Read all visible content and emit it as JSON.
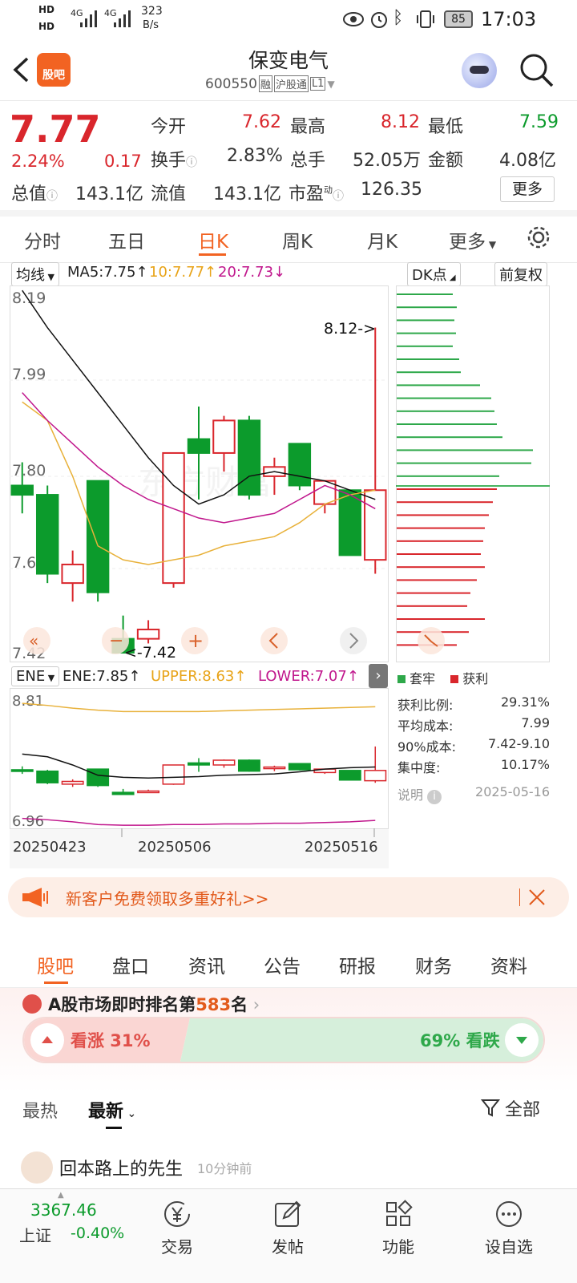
{
  "status_bar": {
    "hd1": "HD",
    "hd2": "HD",
    "sig1": "4G",
    "sig2": "4G",
    "speed_value": "323",
    "speed_unit": "B/s",
    "battery": "85",
    "time": "17:03"
  },
  "header": {
    "logo_text": "股吧",
    "title": "保变电气",
    "code": "600550",
    "tag_rong": "融",
    "tag_hgt": "沪股通",
    "tag_level": "L1"
  },
  "quote": {
    "price": "7.77",
    "change_pct": "2.24%",
    "change": "0.17",
    "open_label": "今开",
    "open": "7.62",
    "high_label": "最高",
    "high": "8.12",
    "low_label": "最低",
    "low": "7.59",
    "turnover_label": "换手",
    "turnover": "2.83%",
    "volume_label": "总手",
    "volume": "52.05万",
    "amount_label": "金额",
    "amount": "4.08亿",
    "mcap_label": "总值",
    "mcap": "143.1亿",
    "float_label": "流值",
    "float": "143.1亿",
    "pe_label": "市盈",
    "pe_sup": "动",
    "pe": "126.35",
    "more_label": "更多"
  },
  "period_tabs": [
    "分时",
    "五日",
    "日K",
    "周K",
    "月K",
    "更多"
  ],
  "active_tab": 2,
  "kline": {
    "ma_selector": "均线",
    "ma5": "MA5:7.75",
    "ma10": "10:7.77",
    "ma20": "20:7.73",
    "dk_label": "DK点",
    "fuquan": "前复权",
    "y_labels": [
      "8.19",
      "7.99",
      "7.80",
      "7.61",
      "7.42"
    ],
    "max_marker": "8.12->",
    "min_marker": "<-7.42",
    "watermark": "东方财富"
  },
  "ene": {
    "selector": "ENE",
    "ene": "ENE:7.85",
    "upper": "UPPER:8.63",
    "lower": "LOWER:7.07",
    "y_top": "8.81",
    "y_bottom": "6.96",
    "dates": [
      "20250423",
      "20250506",
      "20250516"
    ]
  },
  "chip": {
    "legend_trap": "套牢",
    "legend_profit": "获利",
    "rows": [
      {
        "label": "获利比例:",
        "value": "29.31%"
      },
      {
        "label": "平均成本:",
        "value": "7.99"
      },
      {
        "label": "90%成本:",
        "value": "7.42-9.10"
      },
      {
        "label": "集中度:",
        "value": "10.17%"
      }
    ],
    "note_label": "说明",
    "date": "2025-05-16"
  },
  "chart_data": {
    "type": "candlestick",
    "dates_shown": [
      "20250423",
      "20250506",
      "20250516"
    ],
    "candles": [
      {
        "open": 7.78,
        "close": 7.76,
        "high": 7.83,
        "low": 7.72
      },
      {
        "open": 7.76,
        "close": 7.59,
        "high": 7.78,
        "low": 7.57
      },
      {
        "open": 7.57,
        "close": 7.61,
        "high": 7.64,
        "low": 7.53
      },
      {
        "open": 7.79,
        "close": 7.55,
        "high": 7.79,
        "low": 7.53
      },
      {
        "open": 7.45,
        "close": 7.42,
        "high": 7.5,
        "low": 7.42
      },
      {
        "open": 7.45,
        "close": 7.47,
        "high": 7.49,
        "low": 7.44
      },
      {
        "open": 7.57,
        "close": 7.85,
        "high": 7.85,
        "low": 7.56
      },
      {
        "open": 7.88,
        "close": 7.85,
        "high": 7.95,
        "low": 7.75
      },
      {
        "open": 7.85,
        "close": 7.92,
        "high": 7.93,
        "low": 7.81
      },
      {
        "open": 7.92,
        "close": 7.76,
        "high": 7.93,
        "low": 7.75
      },
      {
        "open": 7.8,
        "close": 7.82,
        "high": 7.84,
        "low": 7.76
      },
      {
        "open": 7.87,
        "close": 7.78,
        "high": 7.87,
        "low": 7.77
      },
      {
        "open": 7.74,
        "close": 7.79,
        "high": 7.79,
        "low": 7.72
      },
      {
        "open": 7.77,
        "close": 7.63,
        "high": 7.77,
        "low": 7.63
      },
      {
        "open": 7.62,
        "close": 7.77,
        "high": 8.12,
        "low": 7.59
      }
    ],
    "ma5": [
      8.2,
      8.12,
      8.05,
      7.98,
      7.91,
      7.84,
      7.78,
      7.74,
      7.76,
      7.8,
      7.81,
      7.8,
      7.79,
      7.77,
      7.75
    ],
    "ma10": [
      7.96,
      7.92,
      7.8,
      7.65,
      7.62,
      7.61,
      7.62,
      7.63,
      7.65,
      7.66,
      7.67,
      7.7,
      7.74,
      7.76,
      7.77
    ],
    "ma20": [
      7.98,
      7.92,
      7.87,
      7.82,
      7.78,
      7.75,
      7.73,
      7.71,
      7.7,
      7.71,
      7.72,
      7.75,
      7.78,
      7.76,
      7.73
    ],
    "ylim": [
      7.42,
      8.19
    ]
  },
  "banner": {
    "text": "新客户免费领取多重好礼>>"
  },
  "news_tabs": [
    "股吧",
    "盘口",
    "资讯",
    "公告",
    "研报",
    "财务",
    "资料"
  ],
  "rank": {
    "prefix": "A股市场即时排名第",
    "number": "583",
    "suffix": "名",
    "up_label": "看涨 31%",
    "down_label": "69% 看跌",
    "up_pct": 31
  },
  "sort": {
    "hot": "最热",
    "new": "最新",
    "filter": "全部"
  },
  "post_preview": {
    "user": "回本路上的先生",
    "time": "10分钟前"
  },
  "bottom_nav": {
    "index_value": "3367.46",
    "index_name": "上证",
    "index_change": "-0.40%",
    "items": [
      "交易",
      "发帖",
      "功能",
      "设自选"
    ]
  }
}
